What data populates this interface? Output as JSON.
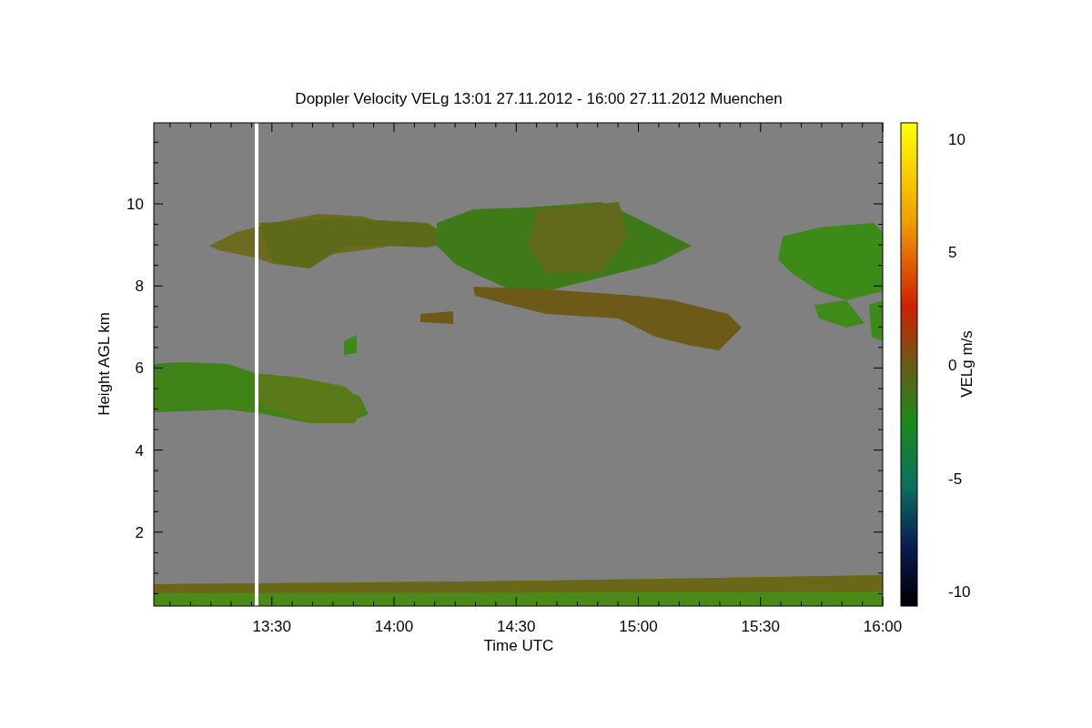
{
  "title": "Doppler Velocity VELg   13:01 27.11.2012 - 16:00 27.11.2012 Muenchen",
  "y_axis": {
    "label": "Height AGL km",
    "ticks": [
      "10",
      "8",
      "6",
      "4",
      "2"
    ]
  },
  "x_axis": {
    "label": "Time UTC",
    "ticks": [
      "13:30",
      "14:00",
      "14:30",
      "15:00",
      "15:30",
      "16:00"
    ]
  },
  "colorbar": {
    "label": "VELg m/s",
    "ticks": [
      "10",
      "5",
      "0",
      "-5",
      "-10"
    ]
  }
}
